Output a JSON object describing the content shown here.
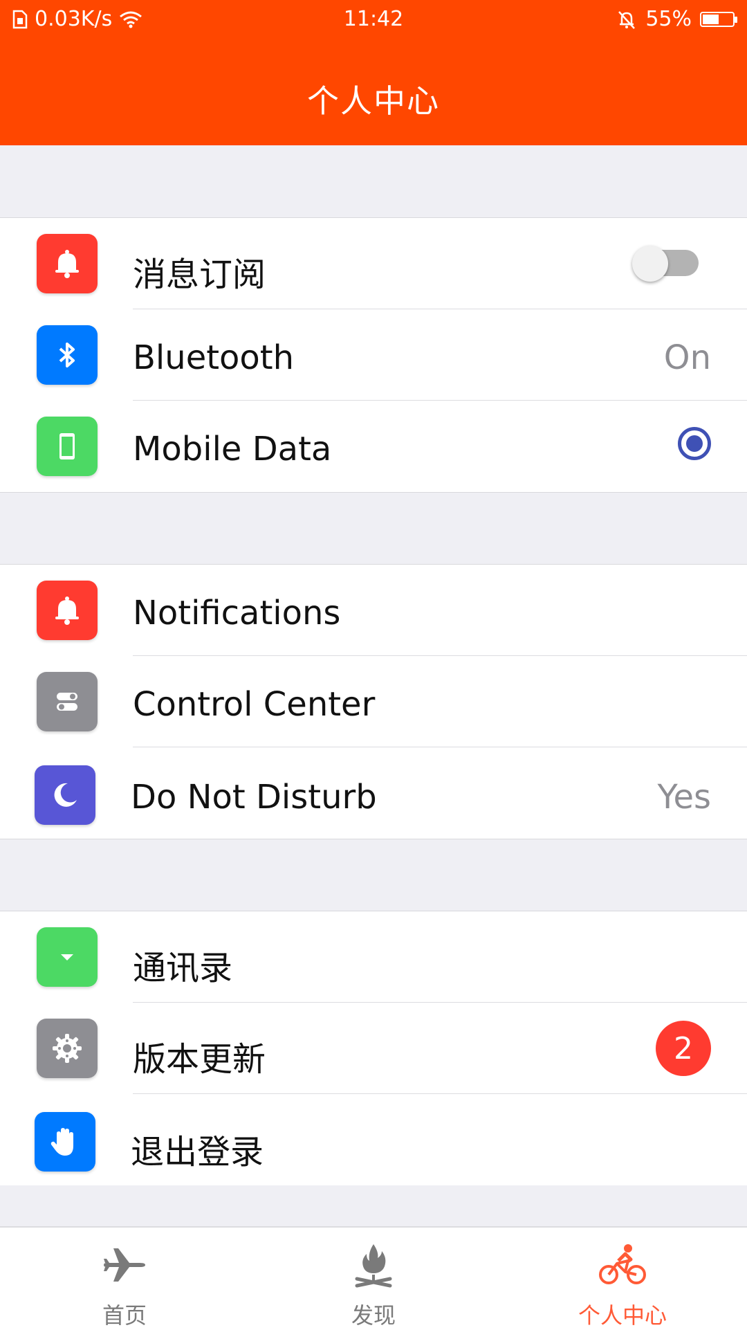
{
  "status_bar": {
    "network_speed": "0.03K/s",
    "time": "11:42",
    "battery": "55%",
    "battery_level": 0.55
  },
  "header": {
    "title": "个人中心"
  },
  "sections": [
    {
      "rows": [
        {
          "label": "消息订阅",
          "icon": "bell-icon",
          "icon_color": "#ff3b30",
          "control": "toggle",
          "toggle_on": false
        },
        {
          "label": "Bluetooth",
          "icon": "bluetooth-icon",
          "icon_color": "#007aff",
          "value": "On"
        },
        {
          "label": "Mobile Data",
          "icon": "phone-icon",
          "icon_color": "#4cd964",
          "control": "radio",
          "radio_selected": true
        }
      ]
    },
    {
      "rows": [
        {
          "label": "Notifications",
          "icon": "bell-icon",
          "icon_color": "#ff3b30"
        },
        {
          "label": "Control Center",
          "icon": "switches-icon",
          "icon_color": "#8e8e93"
        },
        {
          "label": "Do Not Disturb",
          "icon": "moon-icon",
          "icon_color": "#5856d6",
          "value": "Yes"
        }
      ]
    },
    {
      "rows": [
        {
          "label": "通讯录",
          "icon": "caret-down-icon",
          "icon_color": "#4cd964"
        },
        {
          "label": "版本更新",
          "icon": "gear-icon",
          "icon_color": "#8e8e93",
          "badge": "2"
        },
        {
          "label": "退出登录",
          "icon": "hand-icon",
          "icon_color": "#007aff"
        }
      ]
    }
  ],
  "tabbar": {
    "tabs": [
      {
        "label": "首页",
        "icon": "airplane-icon",
        "active": false
      },
      {
        "label": "发现",
        "icon": "fire-icon",
        "active": false
      },
      {
        "label": "个人中心",
        "icon": "bicycle-icon",
        "active": true
      }
    ],
    "active_color": "#ff5a36"
  },
  "colors": {
    "primary": "#ff4700",
    "background": "#efeff4"
  }
}
